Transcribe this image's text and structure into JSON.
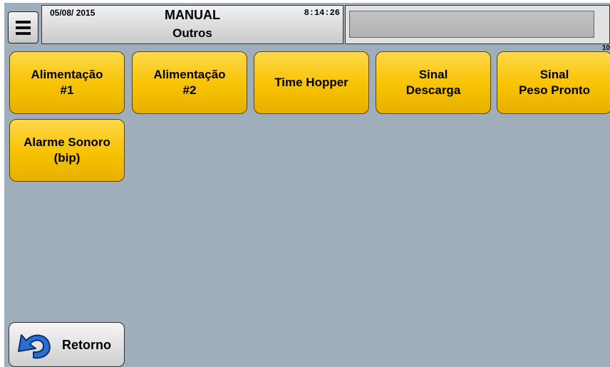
{
  "header": {
    "menu_icon": "hamburger-menu-icon",
    "date": "05/08/ 2015",
    "mode": "MANUAL",
    "submode": "Outros",
    "time": "8:14:26",
    "message": "",
    "corner_mark": "10"
  },
  "buttons": [
    {
      "label": "Alimentação\n#1"
    },
    {
      "label": "Alimentação\n#2"
    },
    {
      "label": "Time Hopper"
    },
    {
      "label": "Sinal\nDescarga"
    },
    {
      "label": "Sinal\nPeso Pronto"
    },
    {
      "label": "Alarme Sonoro\n(bip)"
    }
  ],
  "footer": {
    "back_label": "Retorno",
    "back_icon": "undo-arrow-icon"
  },
  "colors": {
    "background": "#a0aebc",
    "button_yellow": "#f7c200",
    "arrow_blue": "#2a6fd0"
  }
}
